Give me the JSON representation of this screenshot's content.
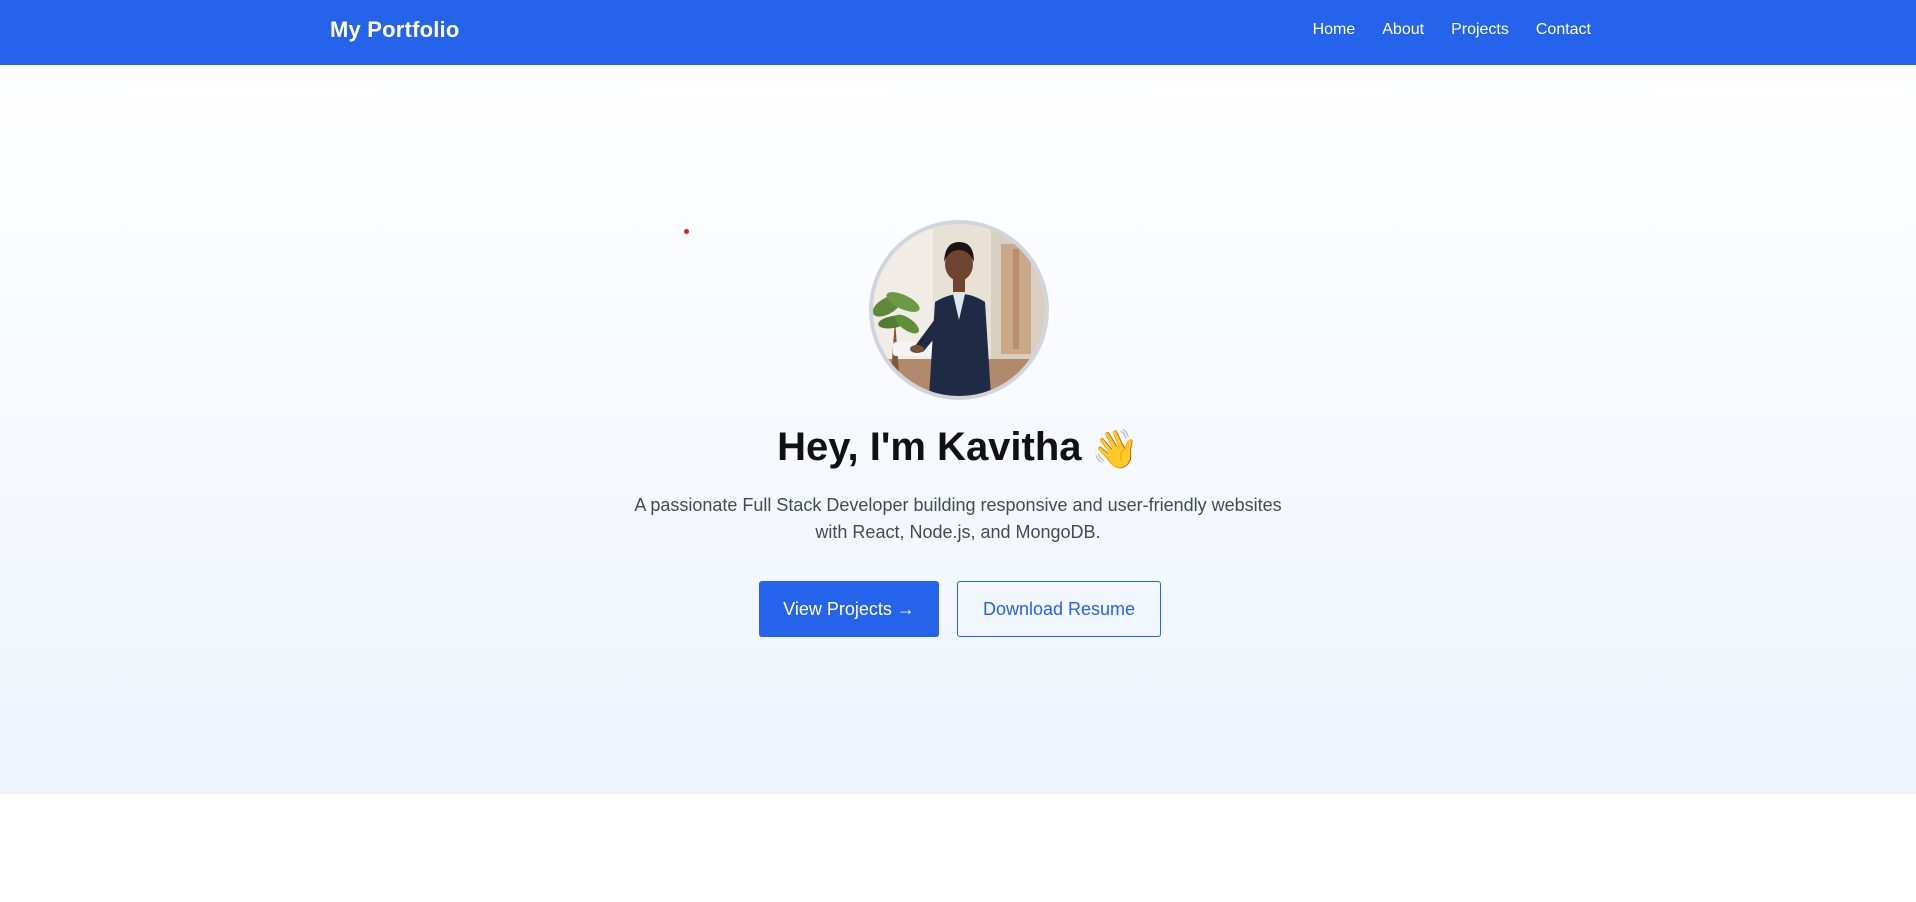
{
  "navbar": {
    "brand": "My Portfolio",
    "links": [
      {
        "label": "Home"
      },
      {
        "label": "About"
      },
      {
        "label": "Projects"
      },
      {
        "label": "Contact"
      }
    ]
  },
  "hero": {
    "title": "Hey, I'm Kavitha",
    "wave_emoji": "👋",
    "description": "A passionate Full Stack Developer building responsive and user-friendly websites with React, Node.js, and MongoDB.",
    "primary_button": "View Projects →",
    "secondary_button": "Download Resume",
    "avatar_icon": "profile-photo"
  },
  "colors": {
    "brand": "#2563eb",
    "nav_text": "#ffffff",
    "title_text": "#111111",
    "body_text": "#444a55"
  }
}
